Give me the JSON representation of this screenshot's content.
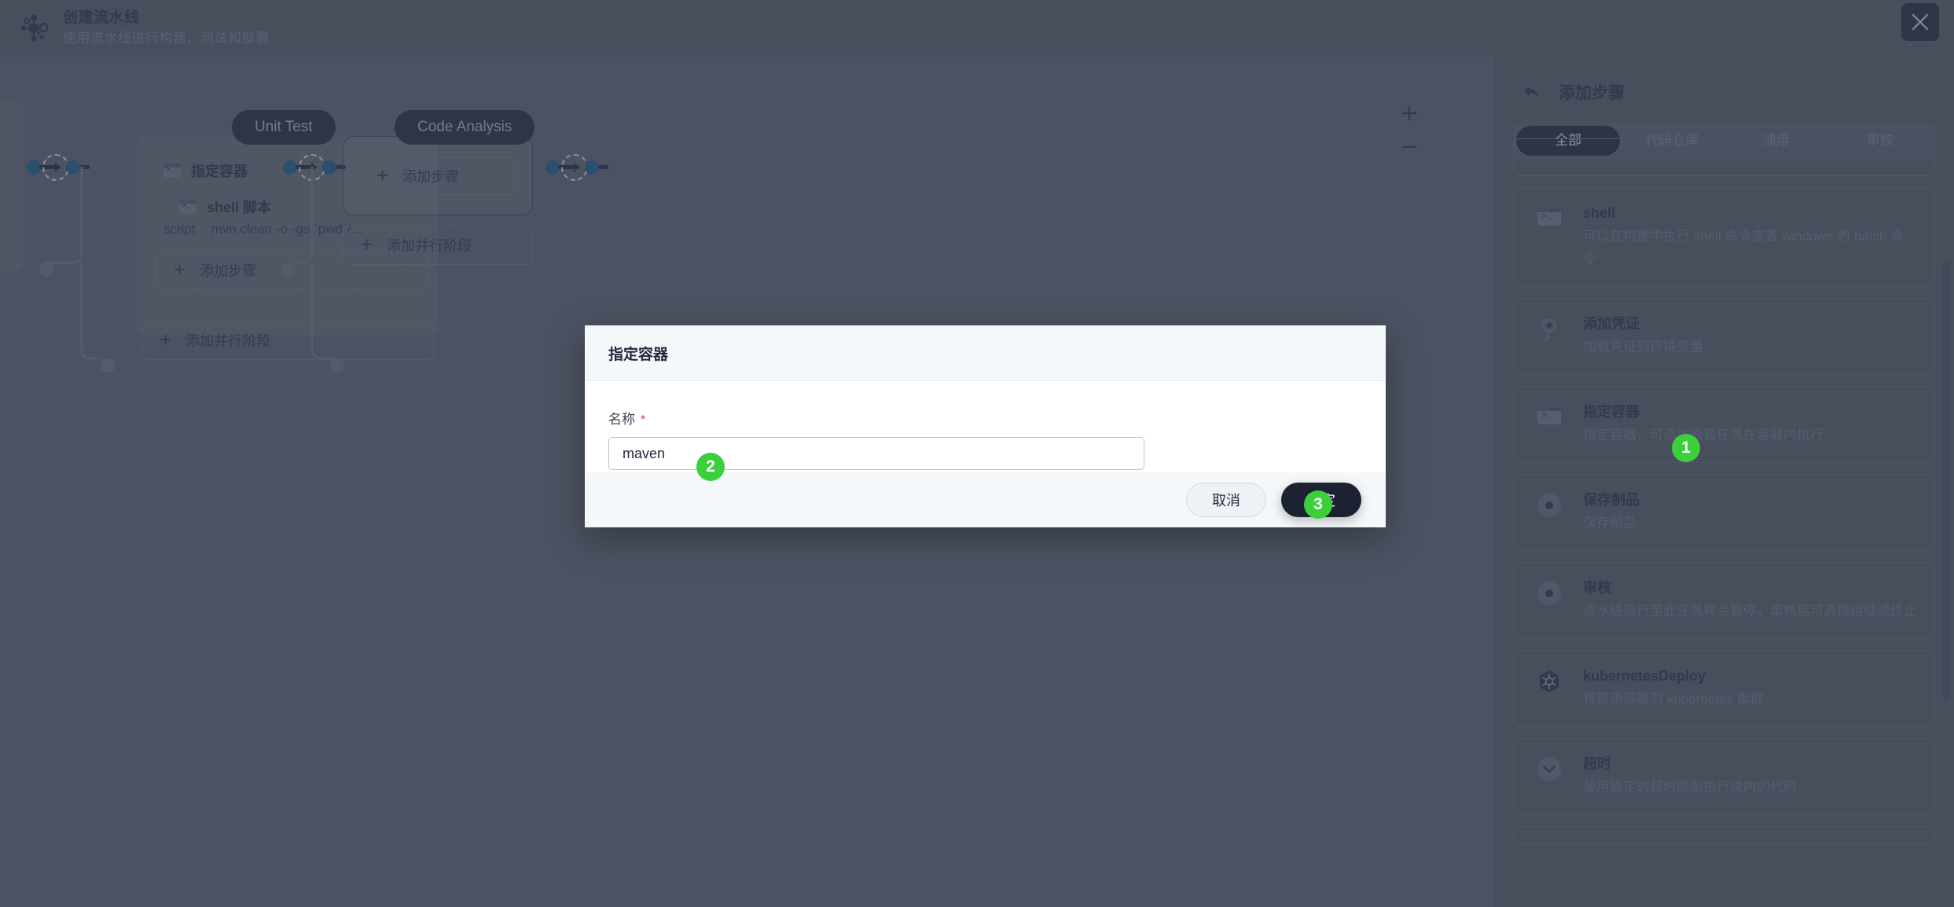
{
  "header": {
    "title": "创建流水线",
    "subtitle": "使用流水线进行构建、测试和部署",
    "logo_icon": "pipeline-nodes-icon",
    "close_icon": "close-icon"
  },
  "canvas": {
    "zoom_in_label": "+",
    "zoom_out_label": "−",
    "stages": [
      {
        "label": "Unit Test",
        "step_title": "指定容器",
        "nested_step_title": "shell 脚本",
        "script_key": "script",
        "script_value": "mvn clean -o -gs `pwd`/...",
        "add_step_label": "添加步骤",
        "add_parallel_label": "添加并行阶段"
      },
      {
        "label": "Code Analysis",
        "add_step_label": "添加步骤",
        "add_parallel_label": "添加并行阶段"
      }
    ]
  },
  "sidebar": {
    "back_icon": "back-arrow-icon",
    "title": "添加步骤",
    "tabs": [
      {
        "label": "全部",
        "active": true
      },
      {
        "label": "代码仓库",
        "active": false
      },
      {
        "label": "通用",
        "active": false
      },
      {
        "label": "审核",
        "active": false
      }
    ],
    "items": [
      {
        "name": "shell",
        "desc": "可以在构建中执行 shell 命令或者 windows 的 batch 命令",
        "icon": "terminal-icon"
      },
      {
        "name": "添加凭证",
        "desc": "加载凭证到环境变量",
        "icon": "key-icon"
      },
      {
        "name": "指定容器",
        "desc": "指定容器，可添加嵌套任务在容器内执行",
        "icon": "terminal-icon"
      },
      {
        "name": "保存制品",
        "desc": "保存制品",
        "icon": "ring-icon"
      },
      {
        "name": "审核",
        "desc": "流水线运行至此任务将会暂停，审核后可选择继续或终止",
        "icon": "ring-icon"
      },
      {
        "name": "kubernetesDeploy",
        "desc": "将资源部署到 kubernetes 集群",
        "icon": "kubernetes-icon"
      },
      {
        "name": "超时",
        "desc": "使用确定的超时限制执行块内的代码.",
        "icon": "chevron-down-icon"
      }
    ]
  },
  "modal": {
    "title": "指定容器",
    "field_label": "名称",
    "required_mark": "*",
    "input_value": "maven",
    "input_placeholder": "",
    "cancel_label": "取消",
    "ok_label": "确定"
  },
  "badges": [
    {
      "number": "1"
    },
    {
      "number": "2"
    },
    {
      "number": "3"
    }
  ],
  "colors": {
    "badge_green": "#3ccf3c",
    "accent_dark": "#1d2233",
    "canvas_bg": "#555c6d",
    "connector_blue": "#1b5886",
    "required_red": "#e23b3b"
  }
}
